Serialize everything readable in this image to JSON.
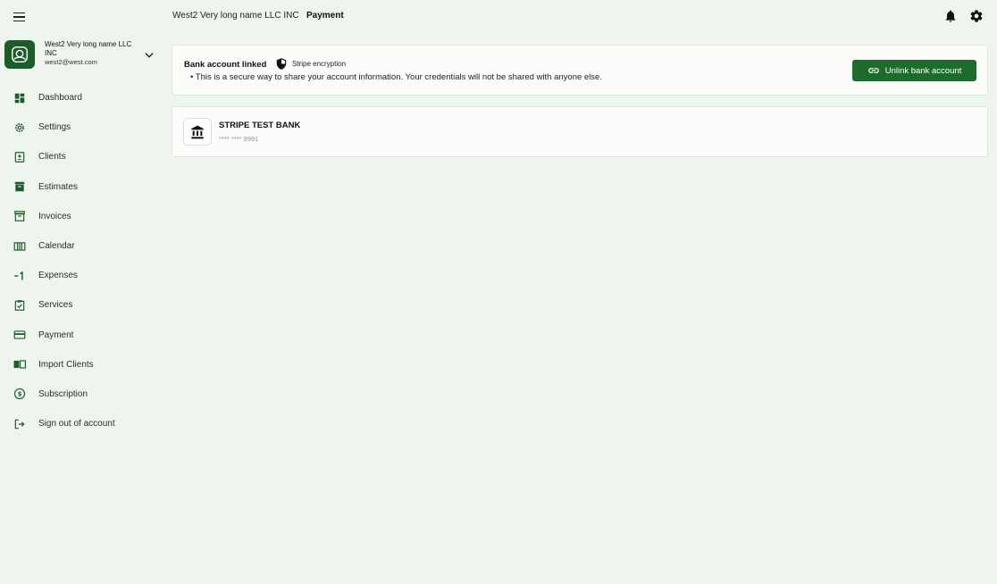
{
  "header": {
    "company_name": "West2 Very long name LLC INC",
    "page_title": "Payment"
  },
  "account": {
    "name": "West2 Very long name LLC INC",
    "email": "west2@west.com"
  },
  "sidebar": {
    "items": [
      {
        "label": "Dashboard",
        "icon": "dashboard-icon"
      },
      {
        "label": "Settings",
        "icon": "settings-icon"
      },
      {
        "label": "Clients",
        "icon": "clients-icon"
      },
      {
        "label": "Estimates",
        "icon": "estimates-icon"
      },
      {
        "label": "Invoices",
        "icon": "invoices-icon"
      },
      {
        "label": "Calendar",
        "icon": "calendar-icon"
      },
      {
        "label": "Expenses",
        "icon": "expenses-icon"
      },
      {
        "label": "Services",
        "icon": "services-icon"
      },
      {
        "label": "Payment",
        "icon": "payment-icon"
      },
      {
        "label": "Import Clients",
        "icon": "import-icon"
      },
      {
        "label": "Subscription",
        "icon": "subscription-icon"
      },
      {
        "label": "Sign out of account",
        "icon": "sign-out-icon"
      }
    ]
  },
  "bank_status": {
    "title": "Bank account linked",
    "encryption_label": "Stripe encryption",
    "note": "• This is a secure way to share your account information. Your credentials will not be shared with anyone else.",
    "unlink_label": "Unlink bank account"
  },
  "bank": {
    "name": "STRIPE TEST BANK",
    "masked_number": "**** **** 9991"
  },
  "colors": {
    "accent": "#1e6b2e",
    "background": "#eef4ee",
    "card": "#fcfcfb"
  }
}
